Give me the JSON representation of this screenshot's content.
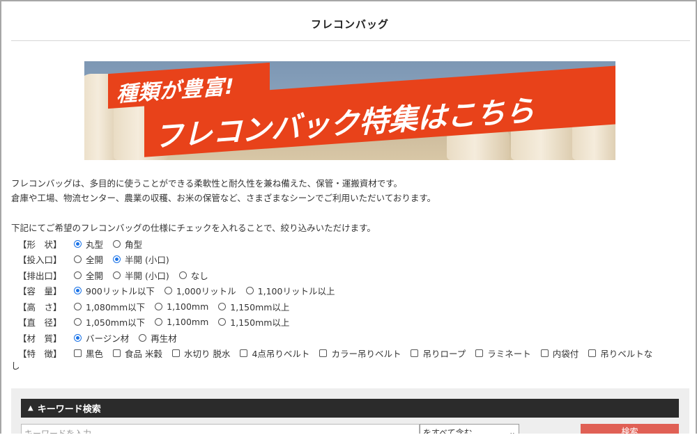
{
  "page": {
    "title": "フレコンバッグ"
  },
  "banner": {
    "line1": "種類が豊富!",
    "line2": "フレコンバック特集はこちら"
  },
  "intro": {
    "line1": "フレコンバッグは、多目的に使うことができる柔軟性と耐久性を兼ね備えた、保管・運搬資材です。",
    "line2": "倉庫や工場、物流センター、農業の収穫、お米の保管など、さまざまなシーンでご利用いただいております。"
  },
  "filter_lead": "下記にてご希望のフレコンバッグの仕様にチェックを入れることで、絞り込みいただけます。",
  "filters": [
    {
      "label": "【形　状】",
      "type": "radio",
      "options": [
        {
          "text": "丸型",
          "checked": true
        },
        {
          "text": "角型",
          "checked": false
        }
      ]
    },
    {
      "label": "【投入口】",
      "type": "radio",
      "options": [
        {
          "text": "全開",
          "checked": false
        },
        {
          "text": "半開 (小口)",
          "checked": true
        }
      ]
    },
    {
      "label": "【排出口】",
      "type": "radio",
      "options": [
        {
          "text": "全開",
          "checked": false
        },
        {
          "text": "半開 (小口)",
          "checked": false
        },
        {
          "text": "なし",
          "checked": false
        }
      ]
    },
    {
      "label": "【容　量】",
      "type": "radio",
      "options": [
        {
          "text": "900リットル以下",
          "checked": true
        },
        {
          "text": "1,000リットル",
          "checked": false
        },
        {
          "text": "1,100リットル以上",
          "checked": false
        }
      ]
    },
    {
      "label": "【高　さ】",
      "type": "radio",
      "options": [
        {
          "text": "1,080mm以下",
          "checked": false
        },
        {
          "text": "1,100mm",
          "checked": false
        },
        {
          "text": "1,150mm以上",
          "checked": false
        }
      ]
    },
    {
      "label": "【直　径】",
      "type": "radio",
      "options": [
        {
          "text": "1,050mm以下",
          "checked": false
        },
        {
          "text": "1,100mm",
          "checked": false
        },
        {
          "text": "1,150mm以上",
          "checked": false
        }
      ]
    },
    {
      "label": "【材　質】",
      "type": "radio",
      "options": [
        {
          "text": "バージン材",
          "checked": true
        },
        {
          "text": "再生材",
          "checked": false
        }
      ]
    },
    {
      "label": "【特　徴】",
      "type": "checkbox",
      "options": [
        {
          "text": "黒色",
          "checked": false
        },
        {
          "text": "食品 米穀",
          "checked": false
        },
        {
          "text": "水切り 脱水",
          "checked": false
        },
        {
          "text": "4点吊りベルト",
          "checked": false
        },
        {
          "text": "カラー吊りベルト",
          "checked": false
        },
        {
          "text": "吊りロープ",
          "checked": false
        },
        {
          "text": "ラミネート",
          "checked": false
        },
        {
          "text": "内袋付",
          "checked": false
        },
        {
          "text": "吊りベルトな",
          "checked": false
        }
      ]
    }
  ],
  "filters_wrap_tail": "し",
  "search": {
    "heading": "キーワード検索",
    "chevron_icon": "chevron-up-icon",
    "input_placeholder": "キーワードを入力",
    "select_value": "をすべて含む",
    "button_label": "検索"
  },
  "colors": {
    "accent_red": "#e8421a",
    "button_red": "#e06055",
    "radio_blue": "#1a73e8",
    "panel_dark": "#2b2b2b"
  }
}
